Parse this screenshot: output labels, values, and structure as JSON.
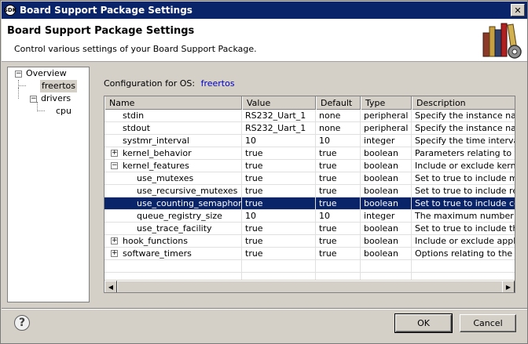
{
  "window": {
    "title": "Board Support Package Settings",
    "close_glyph": "✕",
    "app_icon_text": "SDK"
  },
  "header": {
    "title": "Board Support Package Settings",
    "subtitle": "Control various settings of your Board Support Package."
  },
  "tree": {
    "items": [
      {
        "label": "Overview",
        "expander": "−"
      },
      {
        "label": "freertos",
        "selected": true
      },
      {
        "label": "drivers",
        "expander": "−"
      },
      {
        "label": "cpu"
      }
    ]
  },
  "config": {
    "label": "Configuration for OS:",
    "os": "freertos"
  },
  "table": {
    "columns": [
      "Name",
      "Value",
      "Default",
      "Type",
      "Description"
    ],
    "rows": [
      {
        "name": "stdin",
        "value": "RS232_Uart_1",
        "default": "none",
        "type": "peripheral",
        "description": "Specify the instance name",
        "indent": 1,
        "expander": ""
      },
      {
        "name": "stdout",
        "value": "RS232_Uart_1",
        "default": "none",
        "type": "peripheral",
        "description": "Specify the instance name",
        "indent": 1,
        "expander": ""
      },
      {
        "name": "systmr_interval",
        "value": "10",
        "default": "10",
        "type": "integer",
        "description": "Specify the time interval fo",
        "indent": 1,
        "expander": ""
      },
      {
        "name": "kernel_behavior",
        "value": "true",
        "default": "true",
        "type": "boolean",
        "description": "Parameters relating to the",
        "indent": 1,
        "expander": "+"
      },
      {
        "name": "kernel_features",
        "value": "true",
        "default": "true",
        "type": "boolean",
        "description": "Include or exclude kernel f",
        "indent": 1,
        "expander": "−"
      },
      {
        "name": "use_mutexes",
        "value": "true",
        "default": "true",
        "type": "boolean",
        "description": "Set to true to include mute",
        "indent": 2,
        "expander": ""
      },
      {
        "name": "use_recursive_mutexes",
        "value": "true",
        "default": "true",
        "type": "boolean",
        "description": "Set to true to include recu",
        "indent": 2,
        "expander": ""
      },
      {
        "name": "use_counting_semaphores",
        "value": "true",
        "default": "true",
        "type": "boolean",
        "description": "Set to true to include coun",
        "indent": 2,
        "expander": "",
        "selected": true
      },
      {
        "name": "queue_registry_size",
        "value": "10",
        "default": "10",
        "type": "integer",
        "description": "The maximum number of q",
        "indent": 2,
        "expander": ""
      },
      {
        "name": "use_trace_facility",
        "value": "true",
        "default": "true",
        "type": "boolean",
        "description": "Set to true to include the l",
        "indent": 2,
        "expander": ""
      },
      {
        "name": "hook_functions",
        "value": "true",
        "default": "true",
        "type": "boolean",
        "description": "Include or exclude applicat",
        "indent": 1,
        "expander": "+"
      },
      {
        "name": "software_timers",
        "value": "true",
        "default": "true",
        "type": "boolean",
        "description": "Options relating to the sof",
        "indent": 1,
        "expander": "+"
      }
    ]
  },
  "scrollbar": {
    "left_glyph": "◀",
    "right_glyph": "▶"
  },
  "footer": {
    "help_glyph": "?",
    "ok": "OK",
    "cancel": "Cancel"
  },
  "colors": {
    "selection": "#0a246a",
    "link": "#0000c0",
    "chrome": "#d4d0c8"
  }
}
